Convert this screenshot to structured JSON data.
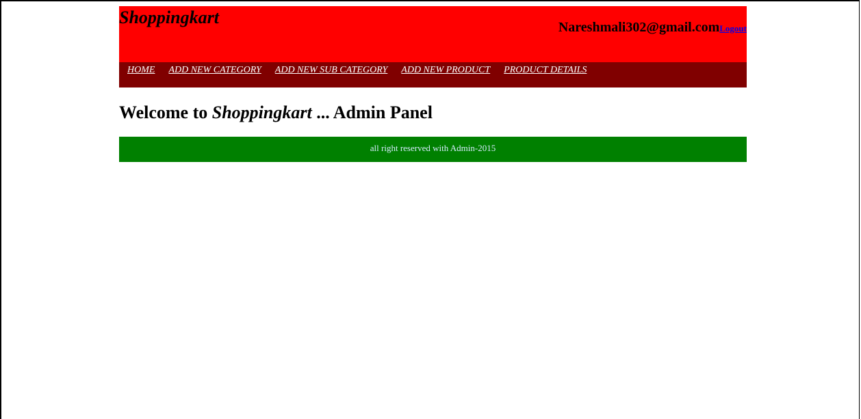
{
  "header": {
    "brand": "Shoppingkart",
    "user_email": "Nareshmali302@gmail.com",
    "logout_label": "Logout",
    "background_color": "#ff0000"
  },
  "nav": {
    "background_color": "#800000",
    "items": [
      {
        "label": "HOME"
      },
      {
        "label": "ADD NEW CATEGORY"
      },
      {
        "label": "ADD NEW SUB CATEGORY"
      },
      {
        "label": "ADD NEW PRODUCT"
      },
      {
        "label": "PRODUCT DETAILS"
      }
    ]
  },
  "main": {
    "welcome_prefix": "Welcome to ",
    "welcome_brand": "Shoppingkart",
    "welcome_suffix": " ... Admin Panel"
  },
  "footer": {
    "text": "all right reserved with Admin-2015",
    "background_color": "#008000"
  }
}
